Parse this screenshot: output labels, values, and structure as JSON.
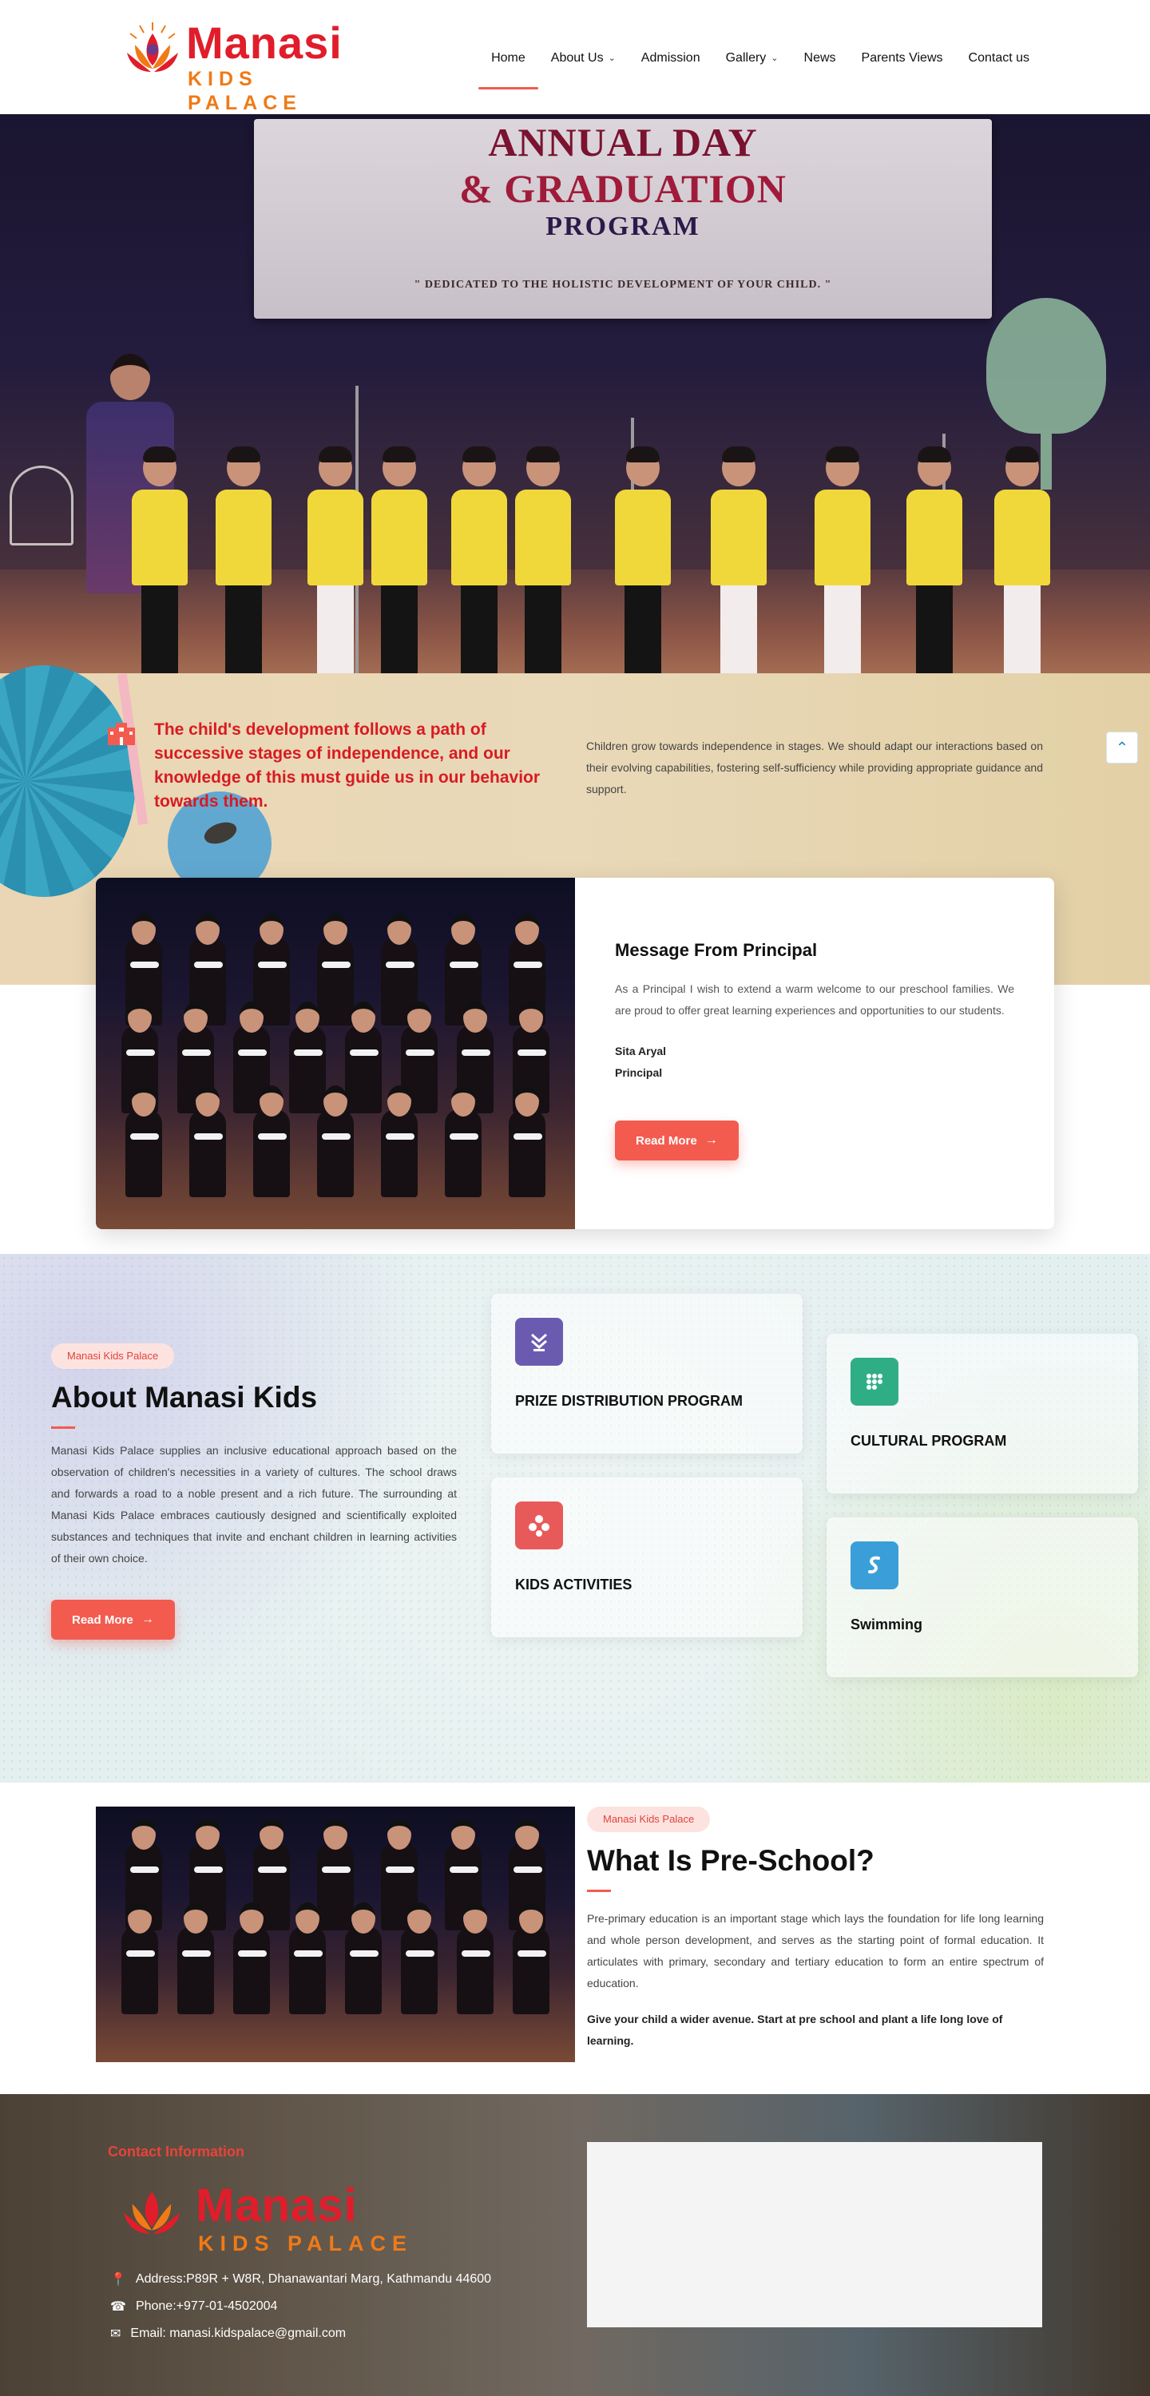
{
  "brand": {
    "name": "Manasi",
    "tagline": "KIDS PALACE",
    "emblem_text": "MANASI",
    "emblem_sub": "KIDS PALACE"
  },
  "nav": {
    "items": [
      {
        "label": "Home",
        "active": true
      },
      {
        "label": "About Us",
        "dropdown": true
      },
      {
        "label": "Admission"
      },
      {
        "label": "Gallery",
        "dropdown": true
      },
      {
        "label": "News"
      },
      {
        "label": "Parents Views"
      },
      {
        "label": "Contact us"
      }
    ]
  },
  "hero": {
    "banner_line1": "ANNUAL DAY",
    "banner_line2": "& GRADUATION",
    "banner_line3": "PROGRAM",
    "banner_line4": "\" DEDICATED TO THE HOLISTIC DEVELOPMENT OF YOUR CHILD. \""
  },
  "quote": {
    "text": "The child's development follows a path of successive stages of independence, and our knowledge of this must guide us in our behavior towards them.",
    "description": "Children grow towards independence in stages. We should adapt our interactions based on their evolving capabilities, fostering self-sufficiency while providing appropriate guidance and support."
  },
  "principal": {
    "title": "Message From Principal",
    "message": "As a Principal   I wish to extend a warm welcome to our preschool families. We are proud to offer great learning experiences and opportunities to our students.",
    "name": "Sita Aryal",
    "role": "Principal",
    "button": "Read More"
  },
  "about": {
    "tag": "Manasi Kids Palace",
    "title": "About Manasi Kids",
    "description": "Manasi Kids Palace supplies an inclusive educational approach based on the observation of children's necessities in a variety of cultures. The school draws and forwards a road to a noble present and a rich future. The surrounding at Manasi Kids Palace embraces cautiously designed and scientifically exploited substances and techniques that invite and enchant children in learning activities of their own choice.",
    "button": "Read More",
    "features": [
      {
        "label": "PRIZE DISTRIBUTION PROGRAM",
        "icon": "prize-icon",
        "color": "#6b5bb0"
      },
      {
        "label": "CULTURAL PROGRAM",
        "icon": "grid-dots-icon",
        "color": "#2fae86"
      },
      {
        "label": "KIDS ACTIVITIES",
        "icon": "activities-icon",
        "color": "#e85a5a"
      },
      {
        "label": "Swimming",
        "icon": "swimming-icon",
        "color": "#3a9fd8"
      }
    ]
  },
  "preschool": {
    "tag": "Manasi Kids Palace",
    "title": "What Is Pre-School?",
    "description": "Pre-primary education is an important stage which lays the foundation for life long learning and whole person development, and serves as the starting point of formal education. It articulates with primary, secondary and tertiary education to form an entire spectrum of education.",
    "highlight": "Give your child a wider avenue. Start at pre school and plant a life long love of learning."
  },
  "contact": {
    "title": "Contact Information",
    "address": "Address:P89R + W8R, Dhanawantari Marg, Kathmandu 44600",
    "phone": "Phone:+977-01-4502004",
    "email": "Email: manasi.kidspalace@gmail.com"
  },
  "colors": {
    "accent": "#f35b4f",
    "brand_red": "#e11d2b",
    "brand_orange": "#f07a16",
    "quote_red": "#d81b23"
  }
}
